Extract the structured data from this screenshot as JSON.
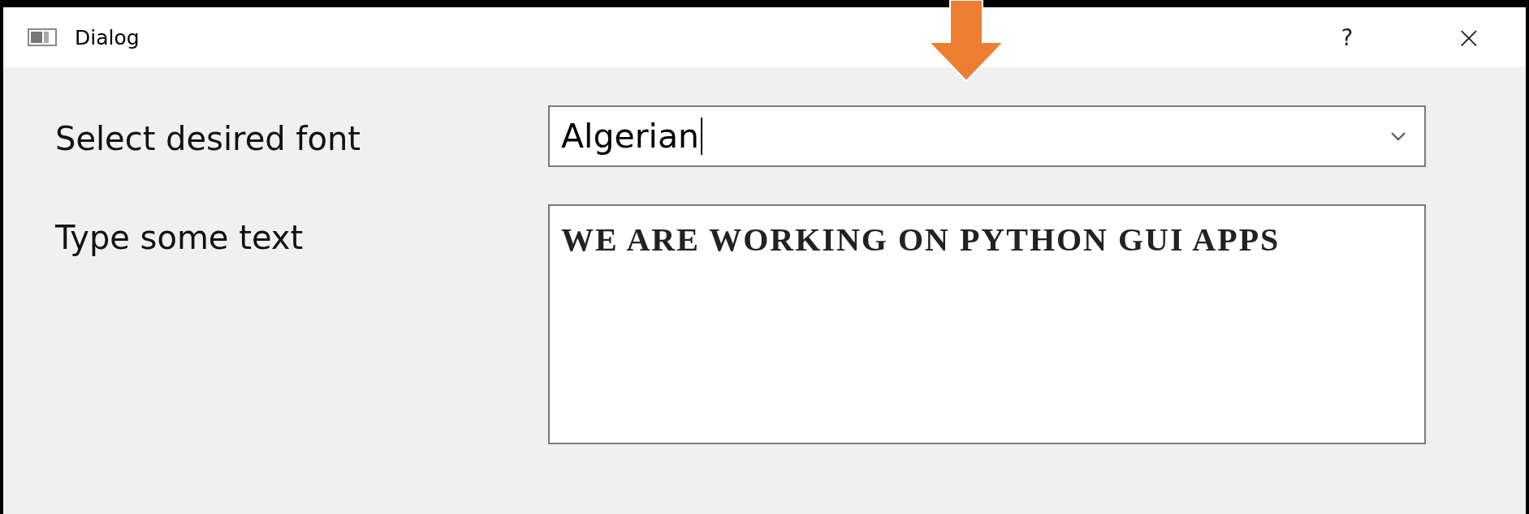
{
  "window": {
    "title": "Dialog",
    "buttons": [
      "?",
      "×"
    ]
  },
  "form": {
    "fields": [
      {
        "label": "Select desired font",
        "kind": "combo",
        "value": "Algerian",
        "focused": true
      },
      {
        "label": "Type some text",
        "kind": "textarea",
        "value": "WE ARE WORKING ON PYTHON GUI APPS"
      }
    ]
  }
}
